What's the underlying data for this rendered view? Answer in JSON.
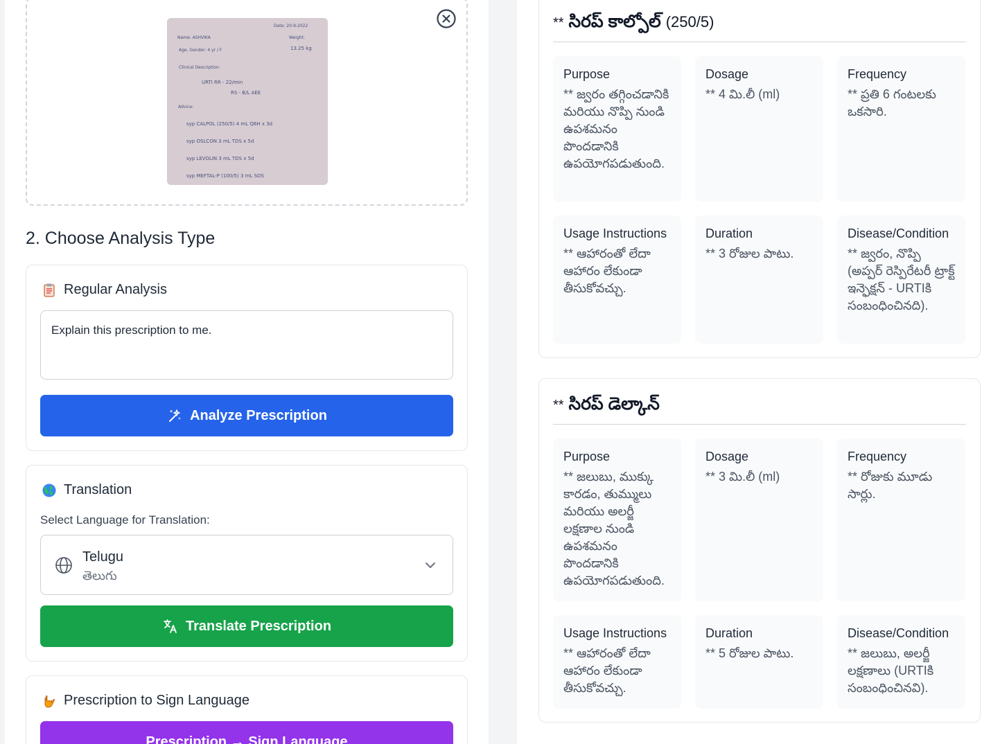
{
  "upload": {
    "photo": {
      "date": "Date: 20-9-2022",
      "name": "Name: ASHVIKA",
      "weight_label": "Weight:",
      "age_gender": "Age, Gender:  4 yr / F",
      "weight": "13.25 kg",
      "clinical_label": "Clinical Description:",
      "dx1": "URTI     RR - 22/min",
      "dx2": "RS - B/L AEE",
      "advice_label": "Advice:",
      "rx1": "syp  CALPOL (250/5)   4 mL  Q6H x 3d",
      "rx2": "syp  OSLCON    3 mL  TDS x 5d",
      "rx3": "syp  LEVOLIN    3 mL  TDS  x  5d",
      "rx4": "syp  MEFTAL-P (100/5)   3 mL  SOS"
    }
  },
  "analysis": {
    "section_title": "2. Choose Analysis Type",
    "regular": {
      "title": "Regular Analysis",
      "prompt_value": "Explain this prescription to me.",
      "button_label": "Analyze Prescription"
    },
    "translation": {
      "title": "Translation",
      "select_label": "Select Language for Translation:",
      "language_name": "Telugu",
      "language_native": "తెలుగు",
      "button_label": "Translate Prescription"
    },
    "sign": {
      "title": "Prescription to Sign Language",
      "button_label": "Prescription → Sign Language"
    }
  },
  "medicines": [
    {
      "prefix": "**",
      "name": "సిరప్ కాల్పోల్",
      "tag": "(250/5)",
      "fields": [
        {
          "label": "Purpose",
          "value": "** జ్వరం తగ్గించడానికి మరియు నొప్పి నుండి ఉపశమనం పొందడానికి ఉపయోగపడుతుంది."
        },
        {
          "label": "Dosage",
          "value": "** 4 మి.లీ (ml)"
        },
        {
          "label": "Frequency",
          "value": "** ప్రతి 6 గంటలకు ఒకసారి."
        },
        {
          "label": "Usage Instructions",
          "value": "** ఆహారంతో లేదా ఆహారం లేకుండా తీసుకోవచ్చు."
        },
        {
          "label": "Duration",
          "value": "** 3 రోజుల పాటు."
        },
        {
          "label": "Disease/Condition",
          "value": "** జ్వరం, నొప్పి (అప్పర్ రెస్పిరేటరీ ట్రాక్ట్ ఇన్ఫెక్షన్ - URTIకి సంబంధించినది)."
        }
      ]
    },
    {
      "prefix": "**",
      "name": "సిరప్ డెల్కాన్",
      "tag": "",
      "fields": [
        {
          "label": "Purpose",
          "value": "** జలుబు, ముక్కు కారడం, తుమ్ములు మరియు అలర్జీ లక్షణాల నుండి ఉపశమనం పొందడానికి ఉపయోగపడుతుంది."
        },
        {
          "label": "Dosage",
          "value": "** 3 మి.లీ (ml)"
        },
        {
          "label": "Frequency",
          "value": "** రోజుకు మూడు సార్లు."
        },
        {
          "label": "Usage Instructions",
          "value": "** ఆహారంతో లేదా ఆహారం లేకుండా తీసుకోవచ్చు."
        },
        {
          "label": "Duration",
          "value": "** 5 రోజుల పాటు."
        },
        {
          "label": "Disease/Condition",
          "value": "** జలుబు, అలర్జీ లక్షణాలు (URTIకి సంబంధించినవి)."
        }
      ]
    }
  ],
  "colors": {
    "analyze_button": "#2563eb",
    "translate_button": "#16a34a",
    "sign_button": "#9333ea"
  },
  "icons": {
    "close": "close-circle-icon",
    "regular": "clipboard-icon",
    "translation": "globe-emoji-icon",
    "sign": "hand-sign-icon",
    "analyze": "sparkles-icon",
    "translate": "translate-icon",
    "language": "globe-icon",
    "dropdown": "chevron-down-icon"
  }
}
